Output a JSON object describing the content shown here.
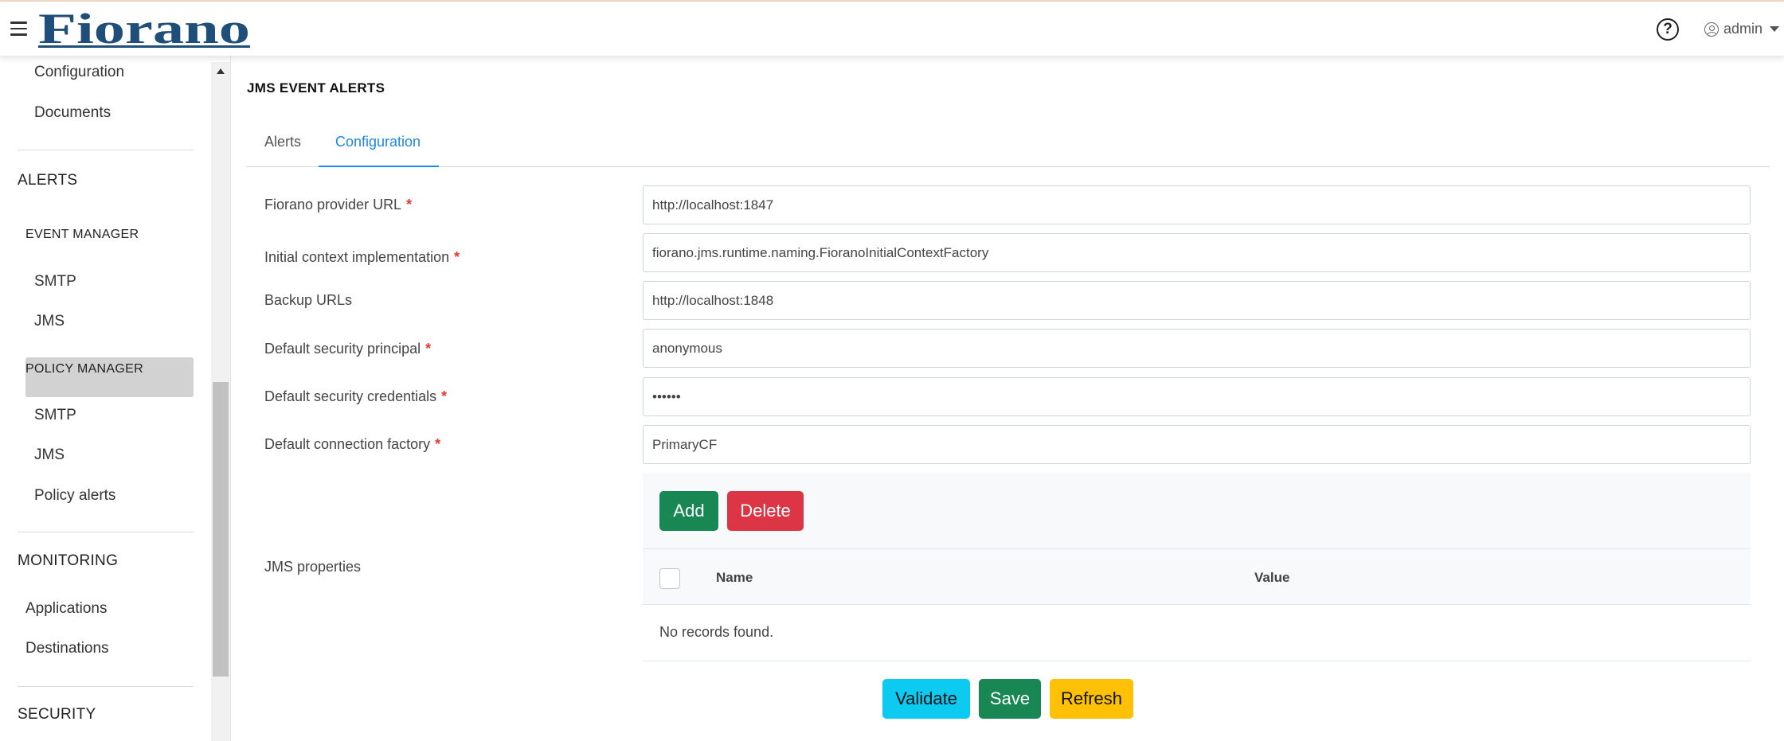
{
  "header": {
    "brand": "Fiorano",
    "help_symbol": "?",
    "user_name": "admin",
    "icons": {
      "menu": "hamburger-icon",
      "help": "question-circle-icon",
      "user": "user-circle-icon",
      "dropdown": "caret-down-icon"
    },
    "colors": {
      "brand_blue": "#1f4e79"
    }
  },
  "sidebar": {
    "top_items": [
      "Configuration",
      "Documents"
    ],
    "alerts_heading": "ALERTS",
    "event_manager_heading": "EVENT MANAGER",
    "event_manager_items": [
      "SMTP",
      "JMS"
    ],
    "active_item": "JMS",
    "policy_manager_heading": "POLICY MANAGER",
    "policy_manager_items": [
      "SMTP",
      "JMS",
      "Policy alerts"
    ],
    "monitoring_heading": "MONITORING",
    "monitoring_items": [
      "Applications",
      "Destinations"
    ],
    "security_heading": "SECURITY"
  },
  "main": {
    "title": "JMS EVENT ALERTS",
    "tabs": [
      {
        "label": "Alerts",
        "active": false
      },
      {
        "label": "Configuration",
        "active": true
      }
    ],
    "fields": [
      {
        "label": "Fiorano provider URL",
        "required": true,
        "value": "http://localhost:1847"
      },
      {
        "label": "Initial context implementation",
        "required": true,
        "value": "fiorano.jms.runtime.naming.FioranoInitialContextFactory"
      },
      {
        "label": "Backup URLs",
        "required": false,
        "value": "http://localhost:1848"
      },
      {
        "label": "Default security principal",
        "required": true,
        "value": "anonymous"
      },
      {
        "label": "Default security credentials",
        "required": true,
        "value": "••••••"
      },
      {
        "label": "Default connection factory",
        "required": true,
        "value": "PrimaryCF"
      }
    ],
    "required_mark": "*",
    "jms_properties": {
      "label": "JMS properties",
      "add_label": "Add",
      "delete_label": "Delete",
      "columns": [
        "Name",
        "Value"
      ],
      "empty_message": "No records found."
    },
    "actions": {
      "validate_label": "Validate",
      "save_label": "Save",
      "refresh_label": "Refresh"
    }
  }
}
